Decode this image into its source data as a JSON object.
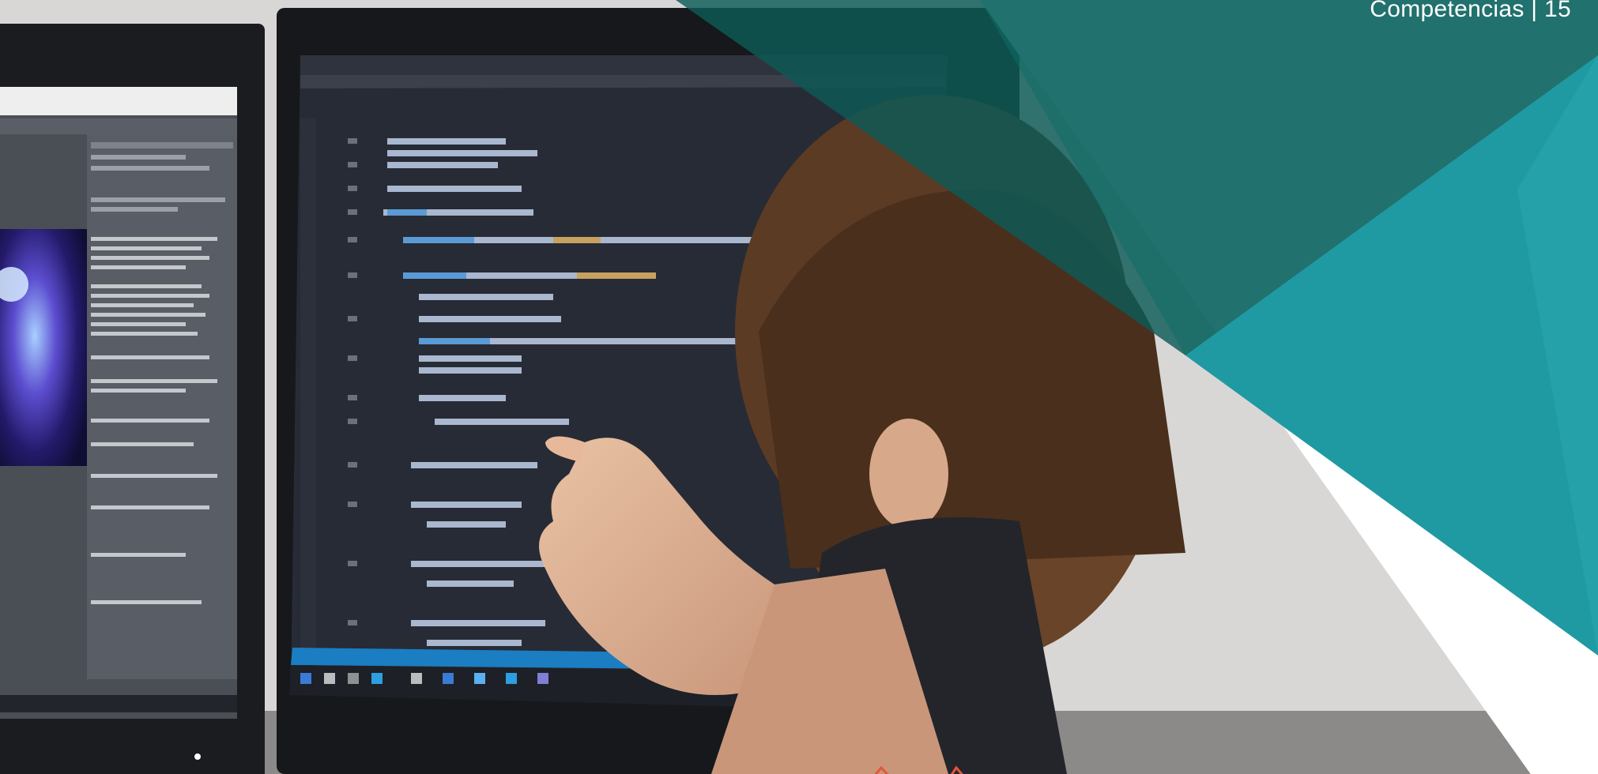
{
  "header": {
    "label": "Competencias | 15"
  },
  "colors": {
    "teal_dark": "#0c5a57",
    "teal": "#1f9aa2",
    "teal_light": "#2aa7ad",
    "accent_red": "#e2563a",
    "editor_bg": "#272b35",
    "background": "#ffffff"
  },
  "photo": {
    "subject": "person-pointing-at-code-on-monitor",
    "left_monitor": "game-engine-inspector-and-nebula-scene",
    "right_monitor": "code-editor-with-csharp-source"
  },
  "decor": {
    "bottom_icon": "red-outline-shape-icon"
  }
}
